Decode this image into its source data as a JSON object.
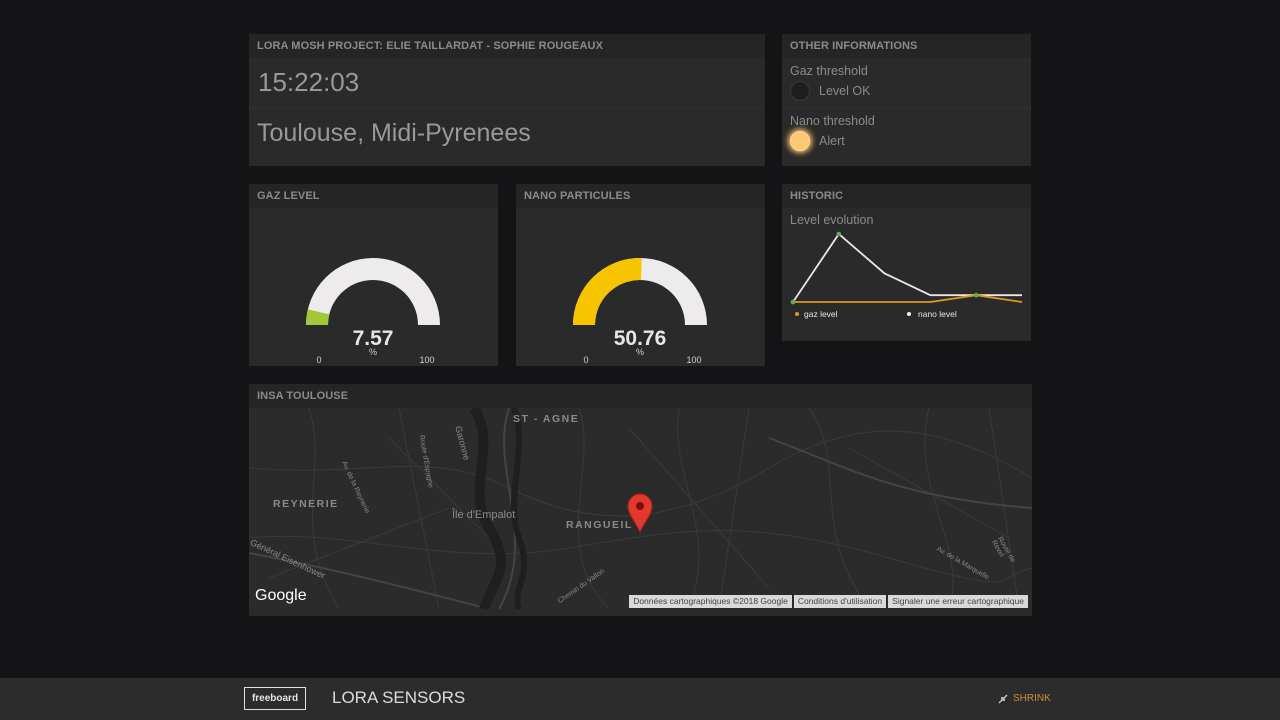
{
  "header_pane": {
    "title": "LORA MOSH PROJECT: ELIE TAILLARDAT - SOPHIE ROUGEAUX",
    "clock": "15:22:03",
    "location": "Toulouse, Midi-Pyrenees"
  },
  "other_info": {
    "title": "OTHER INFORMATIONS",
    "indicators": [
      {
        "label": "Gaz threshold",
        "state_text": "Level OK",
        "active": false,
        "color_off": "#1e1e1e",
        "color_on": "#ffc773"
      },
      {
        "label": "Nano threshold",
        "state_text": "Alert",
        "active": true,
        "color_off": "#1e1e1e",
        "color_on": "#ffc773"
      }
    ]
  },
  "gaz_level": {
    "title": "GAZ LEVEL",
    "value": 7.57,
    "value_text": "7.57",
    "units": "%",
    "min": 0,
    "max": 100,
    "min_text": "0",
    "max_text": "100",
    "fill_color": "#a4c639",
    "track_color": "#edebeb"
  },
  "nano_particules": {
    "title": "NANO PARTICULES",
    "value": 50.76,
    "value_text": "50.76",
    "units": "%",
    "min": 0,
    "max": 100,
    "min_text": "0",
    "max_text": "100",
    "fill_color": "#f6c500",
    "track_color": "#edebeb"
  },
  "historic": {
    "title": "HISTORIC",
    "subtitle": "Level evolution",
    "legend": [
      {
        "name": "gaz level",
        "color": "#e4961d"
      },
      {
        "name": "nano level",
        "color": "#f0f0f0"
      }
    ]
  },
  "chart_data": {
    "type": "line",
    "title": "Level evolution",
    "x": [
      1,
      2,
      3,
      4,
      5,
      6
    ],
    "series": [
      {
        "name": "nano level",
        "color": "#e8e8e8",
        "values": [
          0,
          100,
          42,
          10,
          10,
          10
        ]
      },
      {
        "name": "gaz level",
        "color": "#e4961d",
        "values": [
          0,
          0,
          0,
          0,
          10,
          0
        ]
      }
    ],
    "ylim": [
      0,
      100
    ],
    "grid": false,
    "legend": "bottom"
  },
  "map_pane": {
    "title": "INSA TOULOUSE",
    "labels": [
      "ST - AGNE",
      "REYNERIE",
      "RANGUEIL",
      "Île d'Empalot",
      "Garonne",
      "Route d'Espagne",
      "Av. de la Reynerie",
      "Chemin du Vallon",
      "Av. de la Marquelle",
      "Route de Revel",
      "Général Eisenhower"
    ],
    "logo": "Google",
    "footer": [
      "Données cartographiques ©2018 Google",
      "Conditions d'utilisation",
      "Signaler une erreur cartographique"
    ],
    "marker_color": "#e2382f"
  },
  "bottom_bar": {
    "brand": "freeboard",
    "title": "LORA SENSORS",
    "shrink_label": "SHRINK",
    "shrink_color": "#c9913a"
  }
}
